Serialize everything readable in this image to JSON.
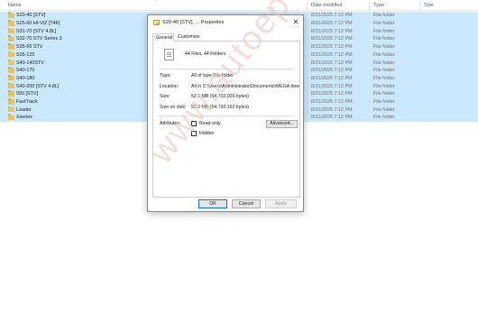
{
  "header": {
    "name": "Name",
    "date_modified": "Date modified",
    "type": "Type",
    "size": "Size",
    "sort_indicator": "^"
  },
  "rows": [
    {
      "name": "S20-40 [STV]",
      "date": "8/31/2025 7:12 PM",
      "type": "File folder",
      "selected": true
    },
    {
      "name": "S25-60 HI-VIZ [T4F]",
      "date": "8/31/2025 7:12 PM",
      "type": "File folder",
      "selected": true
    },
    {
      "name": "S31-70 [STV 4.8L]",
      "date": "8/31/2025 7:12 PM",
      "type": "File folder",
      "selected": true
    },
    {
      "name": "S32-70 STV Series 3",
      "date": "8/31/2025 7:12 PM",
      "type": "File folder",
      "selected": true
    },
    {
      "name": "S35-65 STV",
      "date": "8/31/2025 7:12 PM",
      "type": "File folder",
      "selected": true
    },
    {
      "name": "S35-125",
      "date": "8/31/2025 7:12 PM",
      "type": "File folder",
      "selected": true
    },
    {
      "name": "S40-140STV",
      "date": "8/31/2025 7:12 PM",
      "type": "File folder",
      "selected": true
    },
    {
      "name": "S40-170",
      "date": "8/31/2025 7:12 PM",
      "type": "File folder",
      "selected": true
    },
    {
      "name": "S40-180",
      "date": "8/31/2025 7:12 PM",
      "type": "File folder",
      "selected": true
    },
    {
      "name": "S40-200 [STV 4.8L]",
      "date": "8/31/2025 7:12 PM",
      "type": "File folder",
      "selected": true
    },
    {
      "name": "930 [STV]",
      "date": "8/31/2025 7:12 PM",
      "type": "File folder",
      "selected": true
    },
    {
      "name": "FastTrack",
      "date": "8/31/2025 7:12 PM",
      "type": "File folder",
      "selected": true
    },
    {
      "name": "Loader",
      "date": "8/31/2025 7:12 PM",
      "type": "File folder",
      "selected": true
    },
    {
      "name": "Xseries",
      "date": "8/31/2025 7:12 PM",
      "type": "File folder",
      "selected": true
    }
  ],
  "dialog": {
    "title": "S20-40 [STV], ... Properties",
    "close_glyph": "✕",
    "tabs": [
      "General",
      "Customize"
    ],
    "summary": "44 Files, 44 Folders",
    "type_label": "Type:",
    "type_value": "All of type File folder",
    "location_label": "Location:",
    "location_value": "All in C:\\Users\\Administrator\\Documents\\MEGA dow",
    "size_label": "Size:",
    "size_value": "52.1 MB (54,702,026 bytes)",
    "size_on_disk_label": "Size on disk:",
    "size_on_disk_value": "52.2 MB (54,792,192 bytes)",
    "attributes_label": "Attributes:",
    "readonly_label": "Read-only",
    "hidden_label": "Hidden",
    "advanced_label": "Advanced...",
    "ok_label": "OK",
    "cancel_label": "Cancel",
    "apply_label": "Apply"
  },
  "watermark": "www.autoepccatalog.com",
  "colors": {
    "selection": "#cce8ff",
    "folder": "#f0c24f",
    "header_text": "#4c607a",
    "watermark": "#e6c3be"
  }
}
